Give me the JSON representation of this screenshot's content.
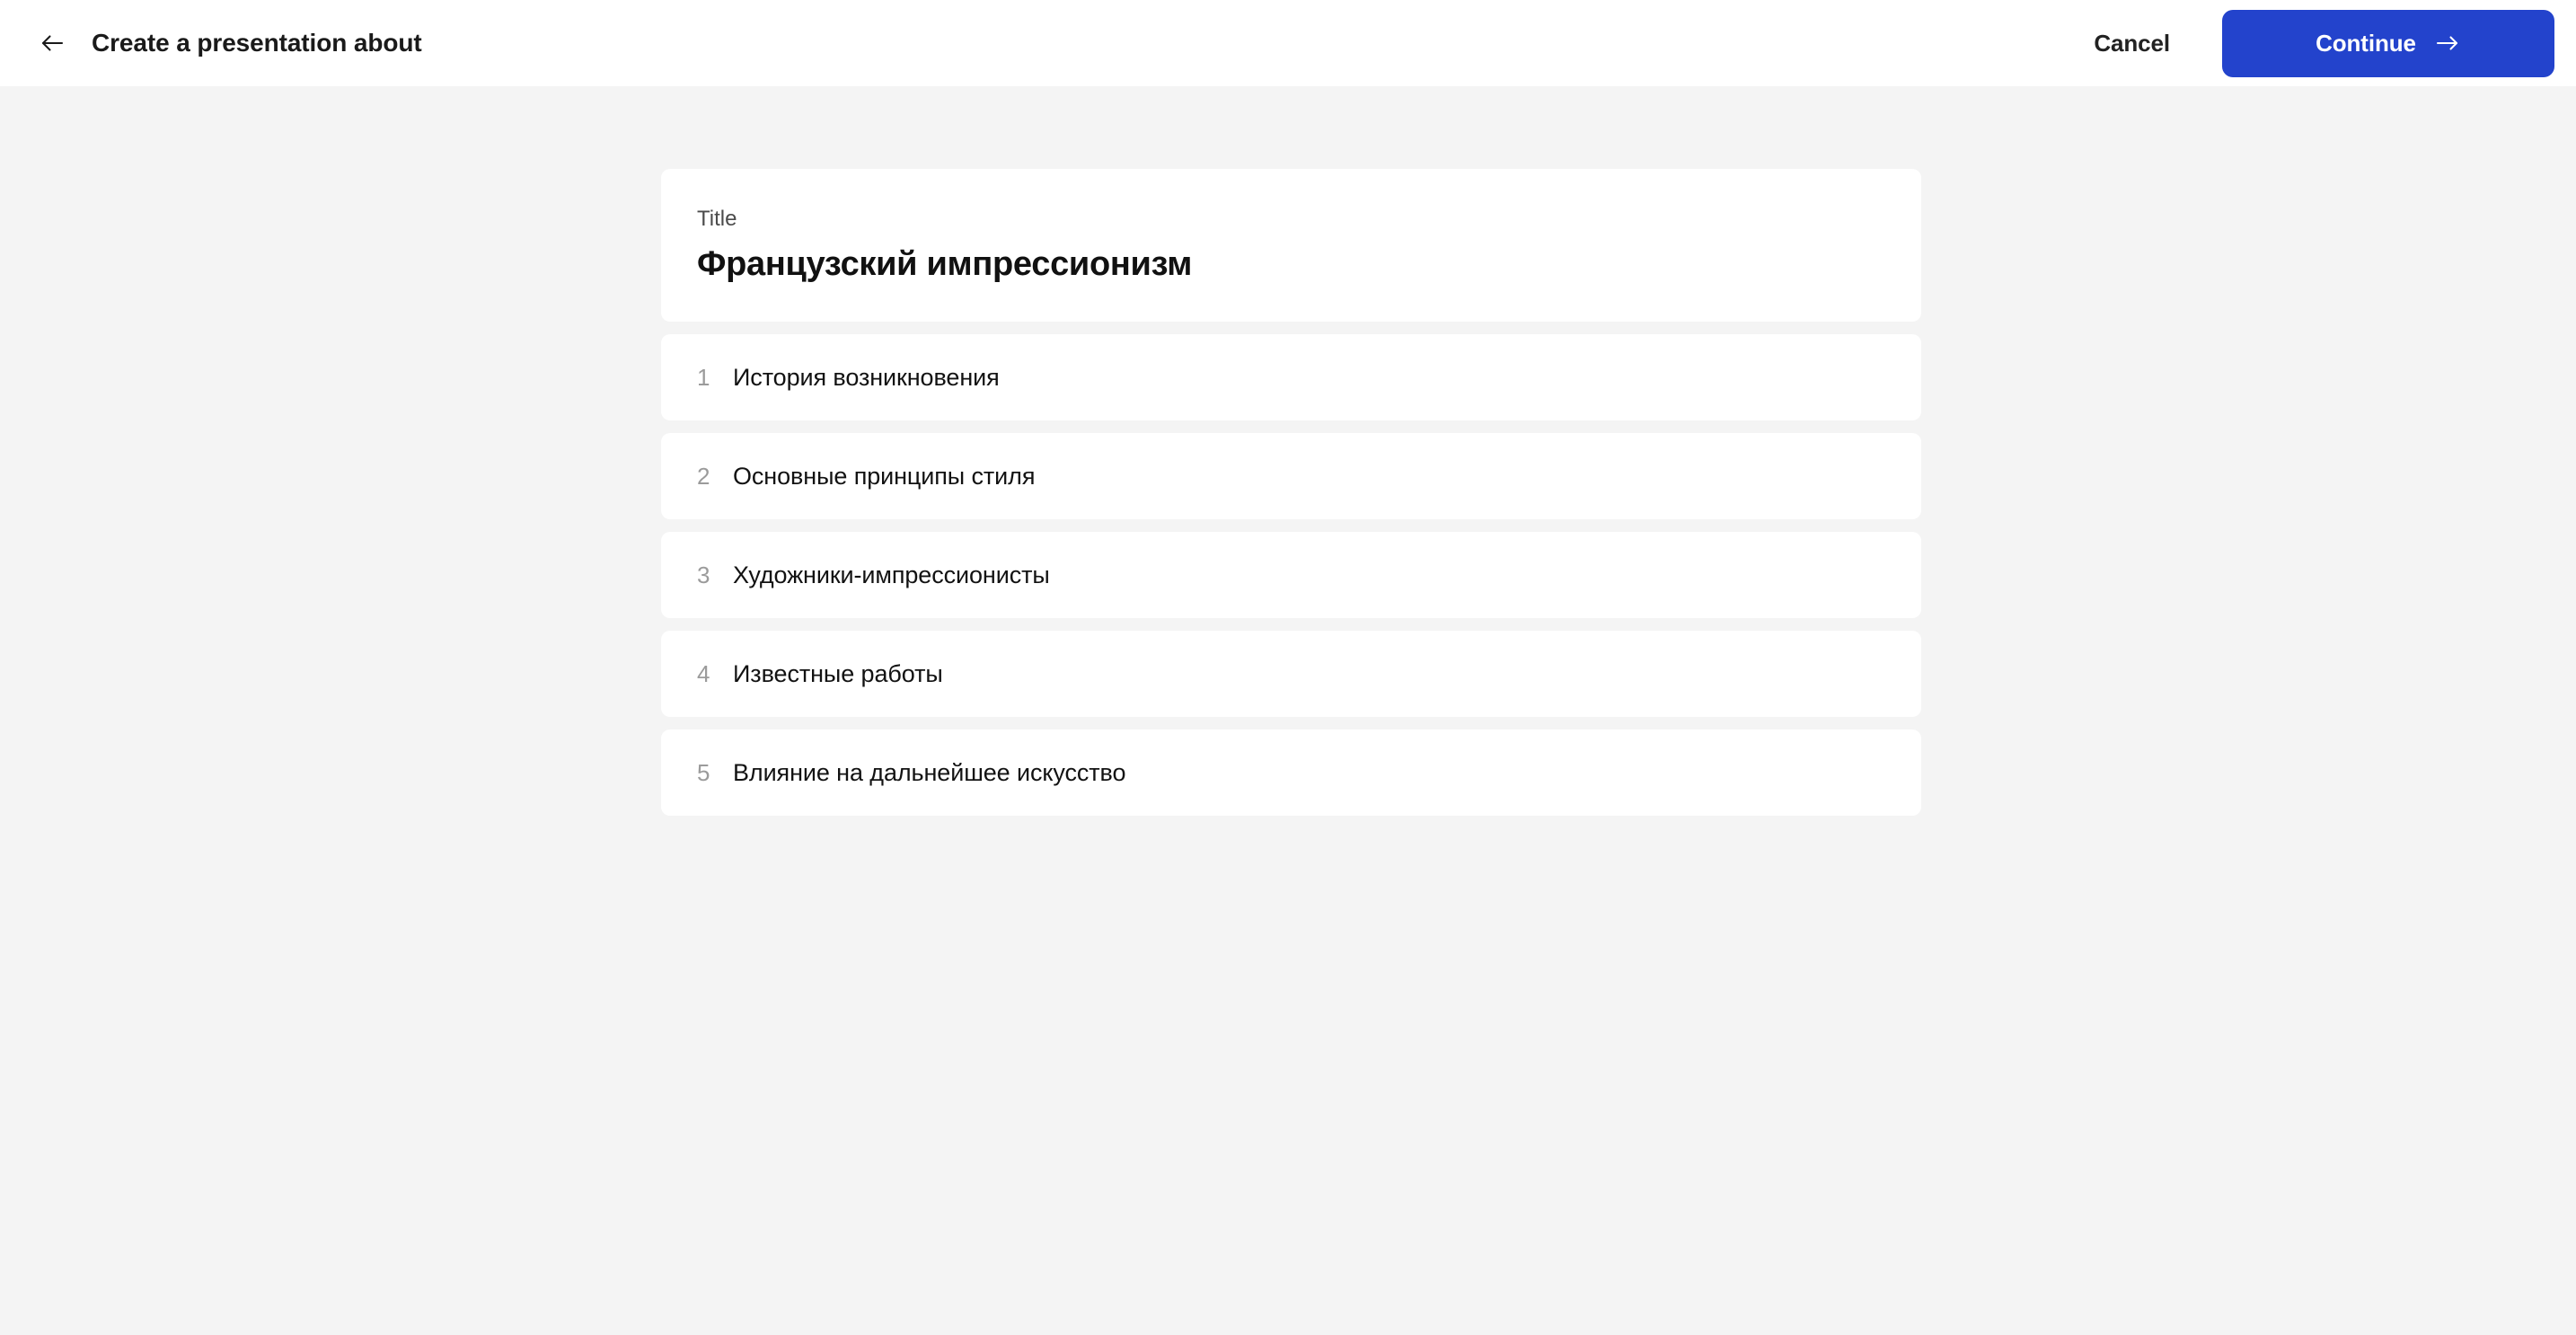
{
  "header": {
    "back_icon": "arrow-left-icon",
    "title": "Create a presentation about",
    "cancel_label": "Cancel",
    "continue_label": "Continue",
    "continue_icon": "arrow-right-icon",
    "accent_color": "#2343cc"
  },
  "outline": {
    "title_label": "Title",
    "title_value": "Французский импрессионизм",
    "rows": [
      {
        "index": "1",
        "label": "История возникновения"
      },
      {
        "index": "2",
        "label": "Основные принципы стиля"
      },
      {
        "index": "3",
        "label": "Художники-импрессионисты"
      },
      {
        "index": "4",
        "label": "Известные работы"
      },
      {
        "index": "5",
        "label": "Влияние на дальнейшее искусство"
      }
    ]
  }
}
